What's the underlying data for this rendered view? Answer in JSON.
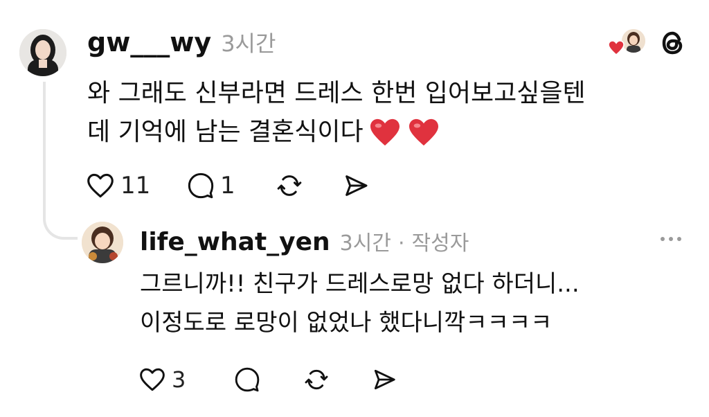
{
  "comment": {
    "username": "gw___wy",
    "time": "3시간",
    "text_line1": "와 그래도 신부라면 드레스 한번 입어보고싶을텐",
    "text_line2": "데 기억에 남는 결혼식이다",
    "emoji": "❤️❤️",
    "likes": "11",
    "replies": "1"
  },
  "reply": {
    "username": "life_what_yen",
    "time": "3시간",
    "separator": "·",
    "author_badge": "작성자",
    "text_line1": "그르니까!! 친구가 드레스로망 없다 하더니...",
    "text_line2": "이정도로 로망이 없었나 했다니깍ㅋㅋㅋㅋ",
    "likes": "3"
  },
  "icons": {
    "like": "heart-outline-icon",
    "comment": "speech-bubble-icon",
    "repost": "repost-arrows-icon",
    "share": "send-arrow-icon",
    "threads": "threads-logo-icon",
    "liked_by_author": "author-heart-avatar-icon",
    "more": "more-horizontal-icon"
  },
  "colors": {
    "heart": "#e0323e",
    "muted": "#9a9a9a",
    "text": "#111111"
  }
}
